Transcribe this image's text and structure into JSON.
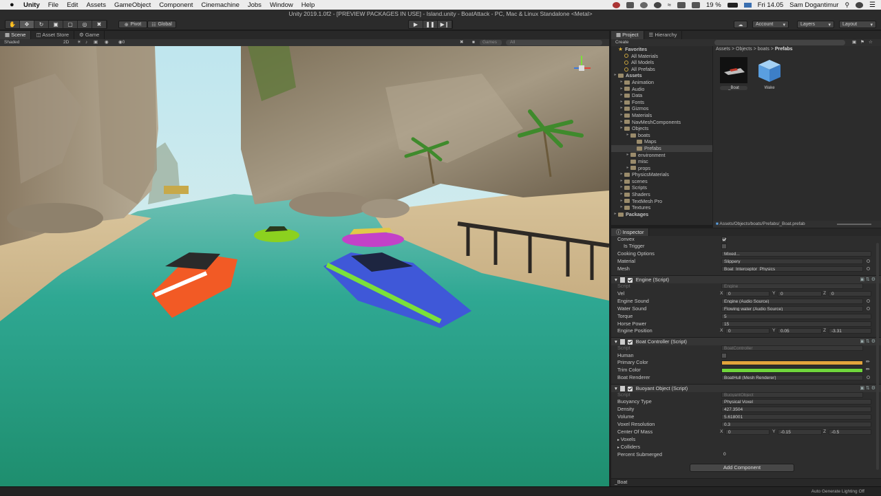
{
  "menubar": {
    "app": "Unity",
    "items": [
      "File",
      "Edit",
      "Assets",
      "GameObject",
      "Component",
      "Cinemachine",
      "Jobs",
      "Window",
      "Help"
    ],
    "battery": "19 %",
    "clock": "Fri 14.05",
    "user": "Sam Dogantimur"
  },
  "toolbar": {
    "window_title": "Unity 2019.1.0f2 - [PREVIEW PACKAGES IN USE] - Island.unity - BoatAttack - PC, Mac & Linux Standalone <Metal>",
    "pivot": "Pivot",
    "global": "Global",
    "account": "Account",
    "layers": "Layers",
    "layout": "Layout"
  },
  "scene": {
    "tabs": [
      "Scene",
      "Asset Store",
      "Game"
    ],
    "shading": "Shaded",
    "mode_2d": "2D",
    "camera_label": "Games",
    "search_all": "All"
  },
  "project": {
    "tabs": [
      "Project",
      "Hierarchy"
    ],
    "create": "Create",
    "tree": [
      {
        "label": "Favorites",
        "depth": 0,
        "kind": "star",
        "bold": true
      },
      {
        "label": "All Materials",
        "depth": 1,
        "kind": "search"
      },
      {
        "label": "All Models",
        "depth": 1,
        "kind": "search"
      },
      {
        "label": "All Prefabs",
        "depth": 1,
        "kind": "search"
      },
      {
        "label": "Assets",
        "depth": 0,
        "kind": "folder",
        "bold": true
      },
      {
        "label": "Animation",
        "depth": 1,
        "kind": "folder"
      },
      {
        "label": "Audio",
        "depth": 1,
        "kind": "folder"
      },
      {
        "label": "Data",
        "depth": 1,
        "kind": "folder"
      },
      {
        "label": "Fonts",
        "depth": 1,
        "kind": "folder"
      },
      {
        "label": "Gizmos",
        "depth": 1,
        "kind": "folder"
      },
      {
        "label": "Materials",
        "depth": 1,
        "kind": "folder"
      },
      {
        "label": "NavMeshComponents",
        "depth": 1,
        "kind": "folder"
      },
      {
        "label": "Objects",
        "depth": 1,
        "kind": "folder"
      },
      {
        "label": "boats",
        "depth": 2,
        "kind": "folder"
      },
      {
        "label": "Maps",
        "depth": 3,
        "kind": "folder"
      },
      {
        "label": "Prefabs",
        "depth": 3,
        "kind": "folder",
        "selected": true
      },
      {
        "label": "environment",
        "depth": 2,
        "kind": "folder"
      },
      {
        "label": "misc",
        "depth": 2,
        "kind": "folder"
      },
      {
        "label": "props",
        "depth": 2,
        "kind": "folder"
      },
      {
        "label": "PhysicsMaterials",
        "depth": 1,
        "kind": "folder"
      },
      {
        "label": "scenes",
        "depth": 1,
        "kind": "folder"
      },
      {
        "label": "Scripts",
        "depth": 1,
        "kind": "folder"
      },
      {
        "label": "Shaders",
        "depth": 1,
        "kind": "folder"
      },
      {
        "label": "TextMesh Pro",
        "depth": 1,
        "kind": "folder"
      },
      {
        "label": "Textures",
        "depth": 1,
        "kind": "folder"
      },
      {
        "label": "Packages",
        "depth": 0,
        "kind": "folder",
        "bold": true
      }
    ],
    "breadcrumb": [
      "Assets",
      "Objects",
      "boats",
      "Prefabs"
    ],
    "assets": [
      {
        "name": "_Boat",
        "icon": "boat-prefab-icon"
      },
      {
        "name": "Wake",
        "icon": "cube-prefab-icon"
      }
    ],
    "path": "Assets/Objects/boats/Prefabs/_Boat.prefab"
  },
  "inspector": {
    "tab": "Inspector",
    "collider": {
      "convex": "Convex",
      "is_trigger": "Is Trigger",
      "cooking_options": "Cooking Options",
      "cooking_value": "Mixed...",
      "material": "Material",
      "material_value": "Slippery",
      "mesh": "Mesh",
      "mesh_value": "Boat_Interceptor_Physics"
    },
    "engine": {
      "title": "Engine (Script)",
      "script": "Script",
      "script_value": "Engine",
      "vel": "Vel",
      "vel_x": "0",
      "vel_y": "0",
      "vel_z": "0",
      "engine_sound": "Engine Sound",
      "engine_sound_value": "Engine (Audio Source)",
      "water_sound": "Water Sound",
      "water_sound_value": "Flowing water (Audio Source)",
      "torque": "Torque",
      "torque_value": "5",
      "horse_power": "Horse Power",
      "horse_power_value": "15",
      "engine_position": "Engine Position",
      "pos_x": "0",
      "pos_y": "0.05",
      "pos_z": "-3.31"
    },
    "boat_controller": {
      "title": "Boat Controller (Script)",
      "script": "Script",
      "script_value": "BoatController",
      "human": "Human",
      "primary_color": "Primary Color",
      "primary_hex": "#e2a43c",
      "trim_color": "Trim Color",
      "trim_hex": "#6fd53c",
      "boat_renderer": "Boat Renderer",
      "boat_renderer_value": "BoatHull (Mesh Renderer)"
    },
    "buoyant": {
      "title": "Buoyant Object (Script)",
      "script": "Script",
      "script_value": "BuoyantObject",
      "buoyancy_type": "Buoyancy Type",
      "buoyancy_value": "Physical Voxel",
      "density": "Density",
      "density_value": "427.3504",
      "volume": "Volume",
      "volume_value": "5.618001",
      "voxel_resolution": "Voxel Resolution",
      "voxel_resolution_value": "0.3",
      "center_of_mass": "Center Of Mass",
      "com_x": "0",
      "com_y": "-0.15",
      "com_z": "-0.5",
      "voxels": "Voxels",
      "colliders": "Colliders",
      "percent_submerged": "Percent Submerged",
      "percent_submerged_value": "0"
    },
    "add_component": "Add Component",
    "selected_name": "_Boat"
  },
  "status": {
    "lighting": "Auto Generate Lighting Off"
  },
  "axis": {
    "x": "X",
    "y": "Y",
    "z": "Z"
  }
}
